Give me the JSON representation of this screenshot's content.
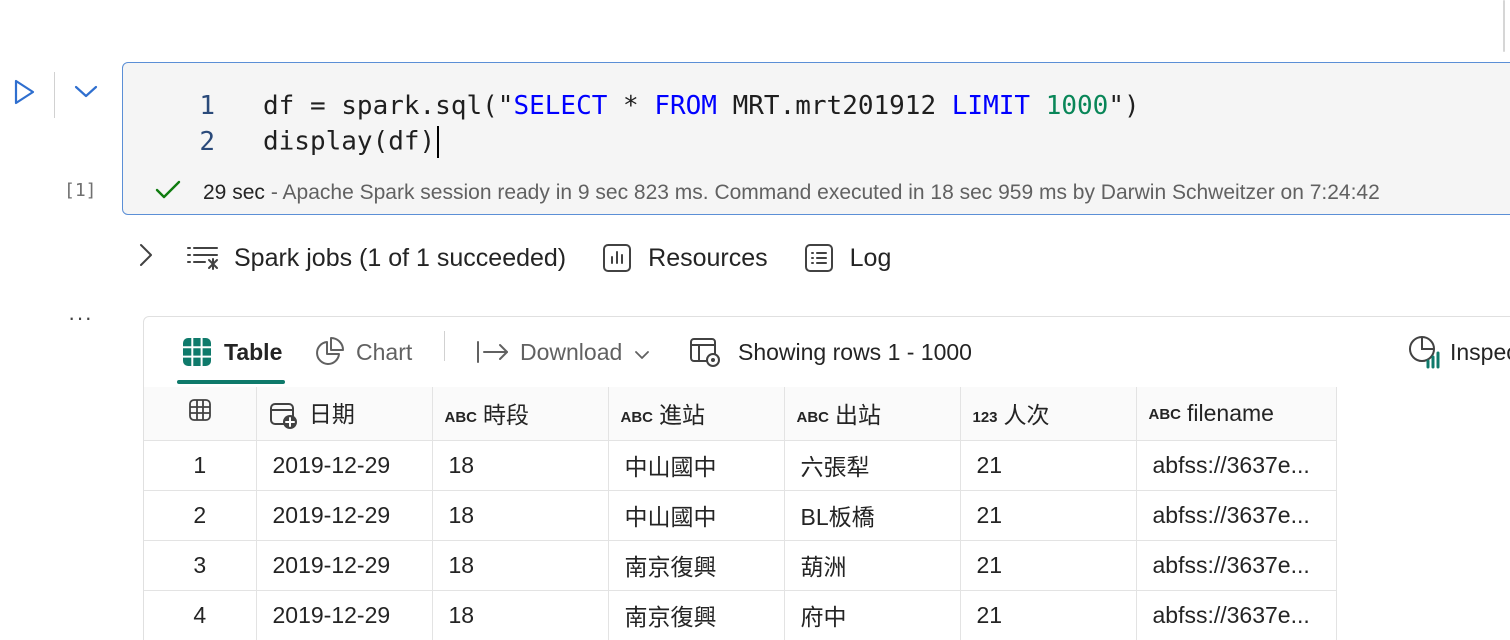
{
  "cell": {
    "execution_count": "[1]",
    "code_lines": [
      {
        "number": "1"
      },
      {
        "number": "2"
      }
    ],
    "code": {
      "l1_a": "df = spark.sql(\"",
      "l1_kw1": "SELECT",
      "l1_b": " * ",
      "l1_kw2": "FROM",
      "l1_c": " MRT.mrt201912 ",
      "l1_kw3": "LIMIT",
      "l1_d": " ",
      "l1_num": "1000",
      "l1_e": "\")",
      "l2": "display(df)"
    },
    "status": {
      "duration": "29 sec",
      "message": "- Apache Spark session ready in 9 sec 823 ms. Command executed in 18 sec 959 ms by Darwin Schweitzer on 7:24:42"
    }
  },
  "jobs_bar": {
    "spark_jobs": "Spark jobs (1 of 1 succeeded)",
    "resources": "Resources",
    "log": "Log"
  },
  "toolbar": {
    "table": "Table",
    "chart": "Chart",
    "download": "Download",
    "showing_rows": "Showing rows 1 - 1000",
    "inspect": "Inspect"
  },
  "table": {
    "columns": [
      {
        "type": "",
        "name": "日期"
      },
      {
        "type": "ABC",
        "name": "時段"
      },
      {
        "type": "ABC",
        "name": "進站"
      },
      {
        "type": "ABC",
        "name": "出站"
      },
      {
        "type": "123",
        "name": "人次"
      },
      {
        "type": "ABC",
        "name": "filename"
      }
    ],
    "rows": [
      {
        "n": "1",
        "cells": [
          "2019-12-29",
          "18",
          "中山國中",
          "六張犁",
          "21",
          "abfss://3637e..."
        ]
      },
      {
        "n": "2",
        "cells": [
          "2019-12-29",
          "18",
          "中山國中",
          "BL板橋",
          "21",
          "abfss://3637e..."
        ]
      },
      {
        "n": "3",
        "cells": [
          "2019-12-29",
          "18",
          "南京復興",
          "葫洲",
          "21",
          "abfss://3637e..."
        ]
      },
      {
        "n": "4",
        "cells": [
          "2019-12-29",
          "18",
          "南京復興",
          "府中",
          "21",
          "abfss://3637e..."
        ]
      }
    ]
  },
  "icons": {
    "run": "play-icon",
    "expand": "chevron-down-icon",
    "success": "checkmark-icon",
    "jobs": "list-icon",
    "resources": "bar-chart-icon",
    "log": "document-list-icon",
    "table": "table-grid-icon",
    "chart": "pie-chart-icon",
    "download": "arrow-export-icon",
    "rows": "table-settings-icon",
    "inspect": "inspect-icon"
  },
  "colors": {
    "accent_border": "#5b8fd6",
    "keyword": "#0000ff",
    "number": "#098658",
    "success": "#107c10",
    "tab_underline": "#0f7a6b"
  }
}
